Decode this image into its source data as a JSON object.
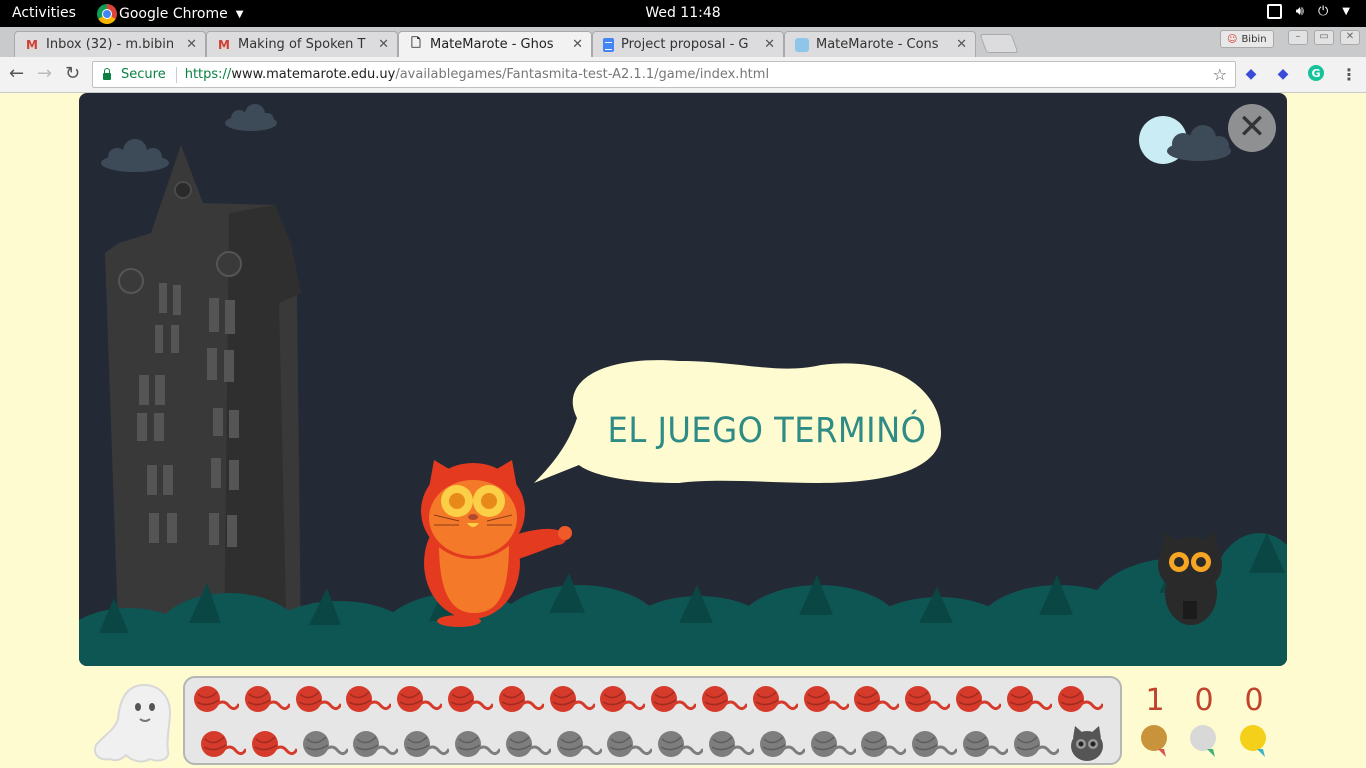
{
  "system_bar": {
    "activities": "Activities",
    "app_name": "Google Chrome",
    "clock": "Wed 11:48"
  },
  "tabs": [
    {
      "title": "Inbox (32) - m.bibin",
      "icon": "gmail-icon",
      "active": false
    },
    {
      "title": "Making of Spoken T",
      "icon": "gmail-icon",
      "active": false
    },
    {
      "title": "MateMarote - Ghos",
      "icon": "page-icon",
      "active": true
    },
    {
      "title": "Project proposal - G",
      "icon": "docs-icon",
      "active": false
    },
    {
      "title": "MateMarote - Cons",
      "icon": "matemarote-icon",
      "active": false
    }
  ],
  "profile_name": "Bibin",
  "address_bar": {
    "secure_label": "Secure",
    "scheme": "https://",
    "host": "www.matemarote.edu.uy",
    "path": "/availablegames/Fantasmita-test-A2.1.1/game/index.html"
  },
  "game": {
    "message": "EL JUEGO TERMINÓ",
    "colors": {
      "sky": "#232a35",
      "bush": "#0e5653",
      "bubble": "#fffbd1",
      "text": "#2e8b86",
      "yarn_red": "#d53a2a",
      "yarn_gray": "#7d7d7d"
    }
  },
  "yarn_rows": {
    "top": {
      "total": 18,
      "red": 18
    },
    "bottom": {
      "total": 17,
      "red": 2
    }
  },
  "scores": [
    {
      "value": "1",
      "medal": "bronze-medal-icon",
      "color": "#c9933c"
    },
    {
      "value": "0",
      "medal": "silver-medal-icon",
      "color": "#d8d8d8"
    },
    {
      "value": "0",
      "medal": "gold-medal-icon",
      "color": "#f5d01b"
    }
  ]
}
